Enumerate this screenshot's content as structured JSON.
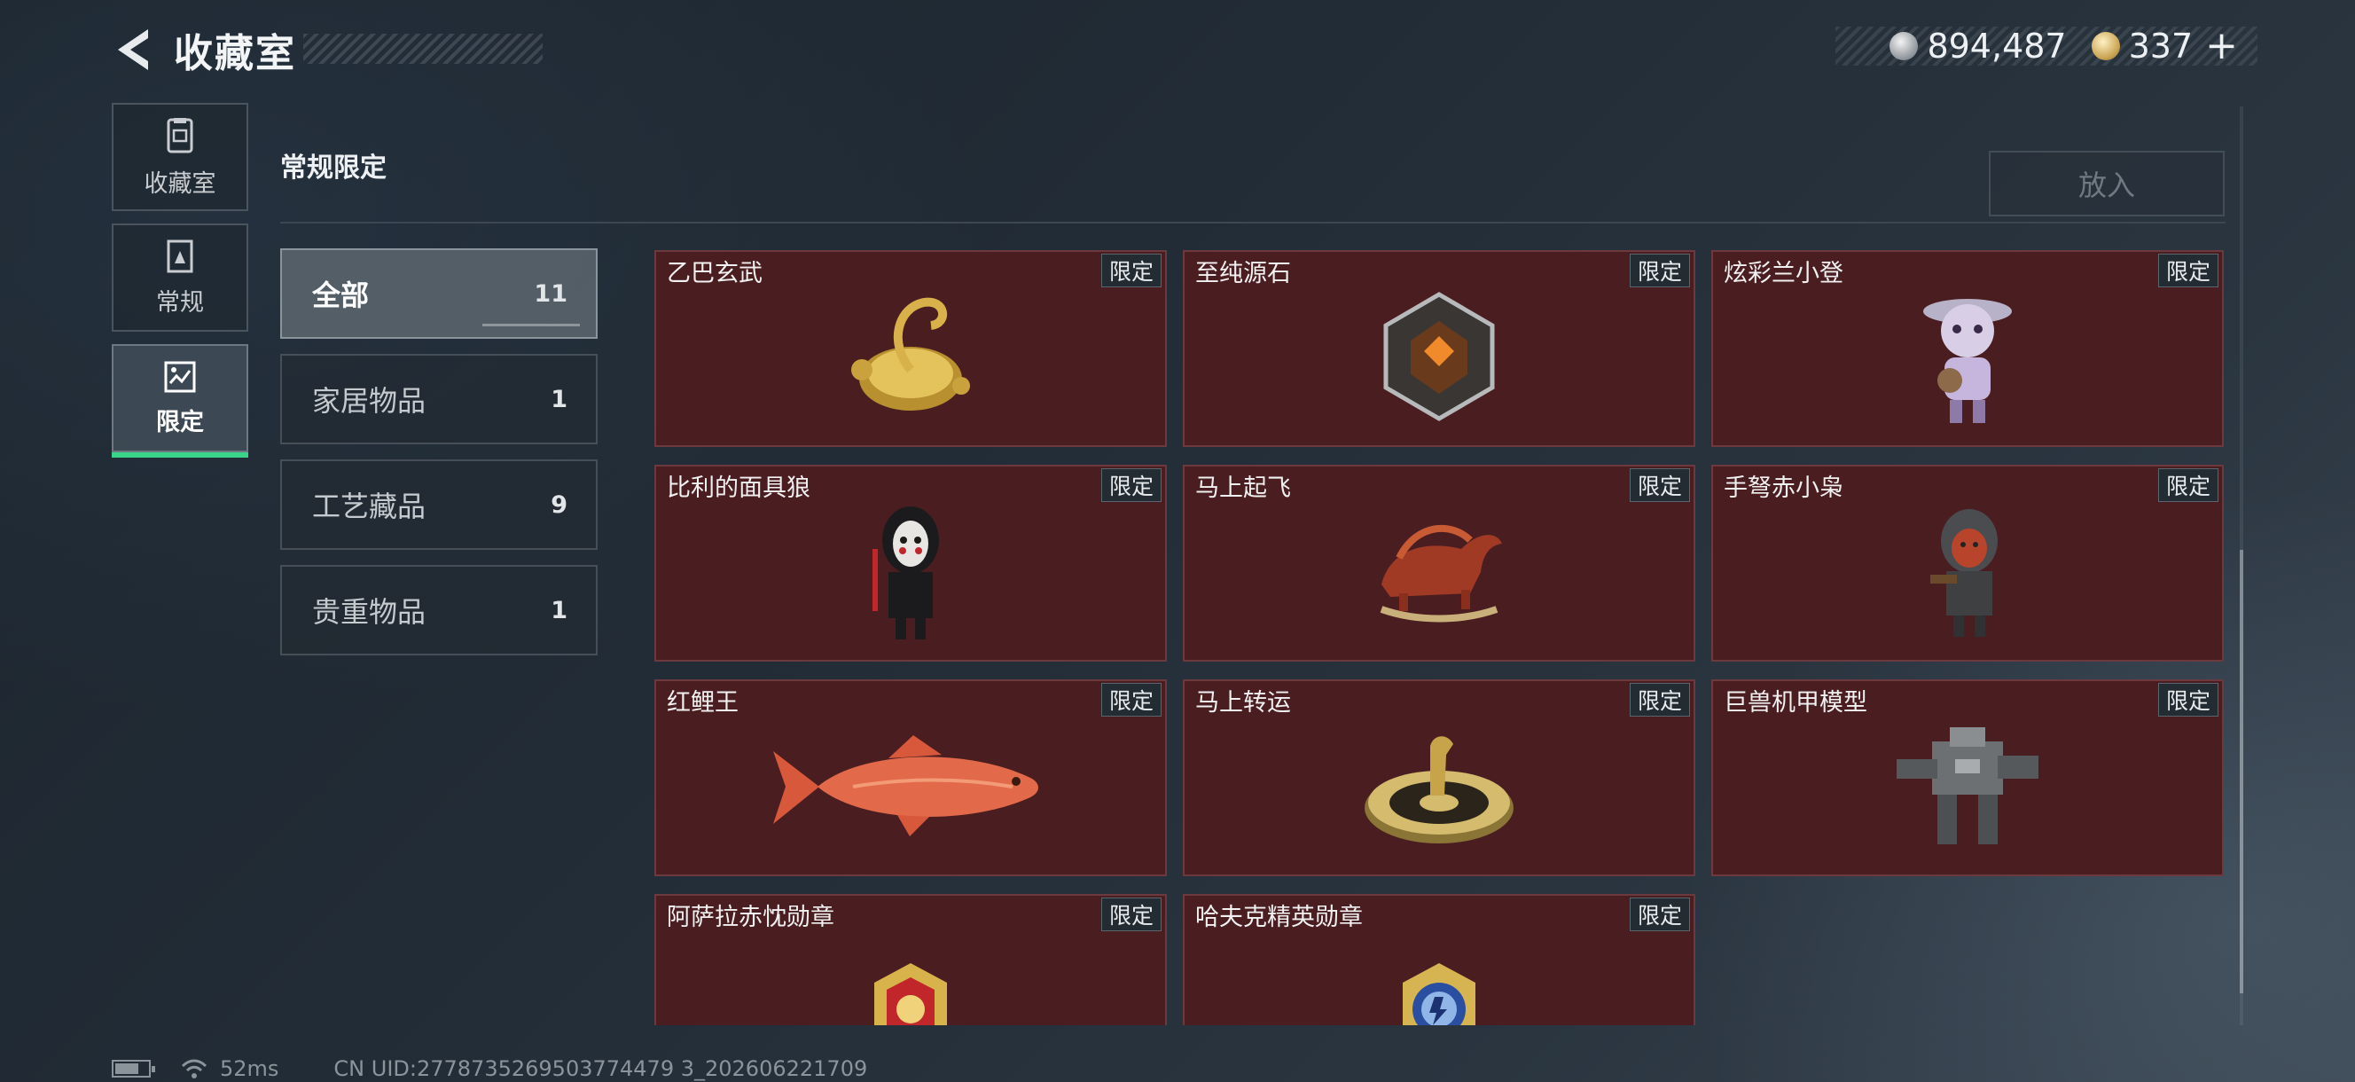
{
  "header": {
    "title": "收藏室",
    "back_icon": "back-arrow-icon"
  },
  "currency": {
    "silver_icon": "silver-coin-icon",
    "silver_value": "894,487",
    "gold_icon": "gold-coin-icon",
    "gold_value": "337",
    "add_label": "+"
  },
  "sidenav": {
    "items": [
      {
        "label": "收藏室",
        "icon": "collection-room-icon",
        "active": false
      },
      {
        "label": "常规",
        "icon": "regular-book-icon",
        "active": false
      },
      {
        "label": "限定",
        "icon": "limited-card-icon",
        "active": true
      }
    ]
  },
  "section": {
    "title": "常规限定",
    "put_button": "放入"
  },
  "categories": [
    {
      "name": "全部",
      "count": "11",
      "active": true
    },
    {
      "name": "家居物品",
      "count": "1",
      "active": false
    },
    {
      "name": "工艺藏品",
      "count": "9",
      "active": false
    },
    {
      "name": "贵重物品",
      "count": "1",
      "active": false
    }
  ],
  "items": [
    {
      "name": "乙巴玄武",
      "tag": "限定",
      "art": "golden-turtle-snake"
    },
    {
      "name": "至纯源石",
      "tag": "限定",
      "art": "dark-crystal"
    },
    {
      "name": "炫彩兰小登",
      "tag": "限定",
      "art": "purple-doll"
    },
    {
      "name": "比利的面具狼",
      "tag": "限定",
      "art": "masked-puppet"
    },
    {
      "name": "马上起飞",
      "tag": "限定",
      "art": "red-horse"
    },
    {
      "name": "手弩赤小枭",
      "tag": "限定",
      "art": "hooded-figure"
    },
    {
      "name": "红鲤王",
      "tag": "限定",
      "art": "red-carp"
    },
    {
      "name": "马上转运",
      "tag": "限定",
      "art": "gold-horse-disc"
    },
    {
      "name": "巨兽机甲模型",
      "tag": "限定",
      "art": "mech-model"
    },
    {
      "name": "阿萨拉赤忱勋章",
      "tag": "限定",
      "art": "gold-medal"
    },
    {
      "name": "哈夫克精英勋章",
      "tag": "限定",
      "art": "blue-medal"
    }
  ],
  "footer": {
    "battery_icon": "battery-icon",
    "wifi_icon": "wifi-icon",
    "ping": "52ms",
    "uid": "CN UID:2778735269503774479 3_202606221709"
  },
  "colors": {
    "card_bg": "#4a1d21",
    "active_indicator": "#39d48a"
  }
}
